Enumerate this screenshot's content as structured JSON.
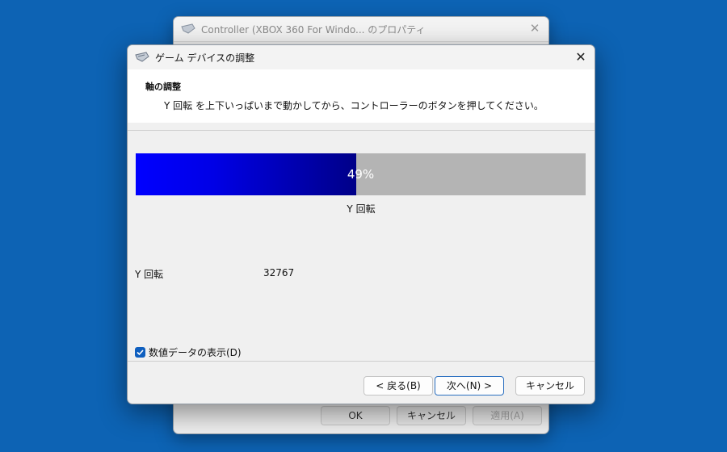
{
  "background_window": {
    "title": "Controller (XBOX 360 For Windo... のプロパティ",
    "buttons": {
      "ok": "OK",
      "cancel": "キャンセル",
      "apply": "適用(A)"
    }
  },
  "dialog": {
    "title": "ゲーム デバイスの調整",
    "section_title": "軸の調整",
    "instruction": "Y 回転 を上下いっぱいまで動かしてから、コントローラーのボタンを押してください。",
    "progress": {
      "value_percent": 49,
      "text": "49%",
      "fill_color": "#0000ff",
      "track_color": "#b4b4b4"
    },
    "axis_label": "Y 回転",
    "raw_data": {
      "label": "Y 回転",
      "value": "32767"
    },
    "show_raw_checkbox": {
      "label": "数値データの表示(D)",
      "checked": true
    },
    "buttons": {
      "back": "< 戻る(B)",
      "next": "次へ(N) >",
      "cancel": "キャンセル"
    }
  },
  "icons": {
    "title_icon": "gamepad-icon",
    "close_icon": "close-icon",
    "check_icon": "checkmark-icon"
  },
  "colors": {
    "desktop": "#0d63b4",
    "accent": "#0f5fbf"
  }
}
